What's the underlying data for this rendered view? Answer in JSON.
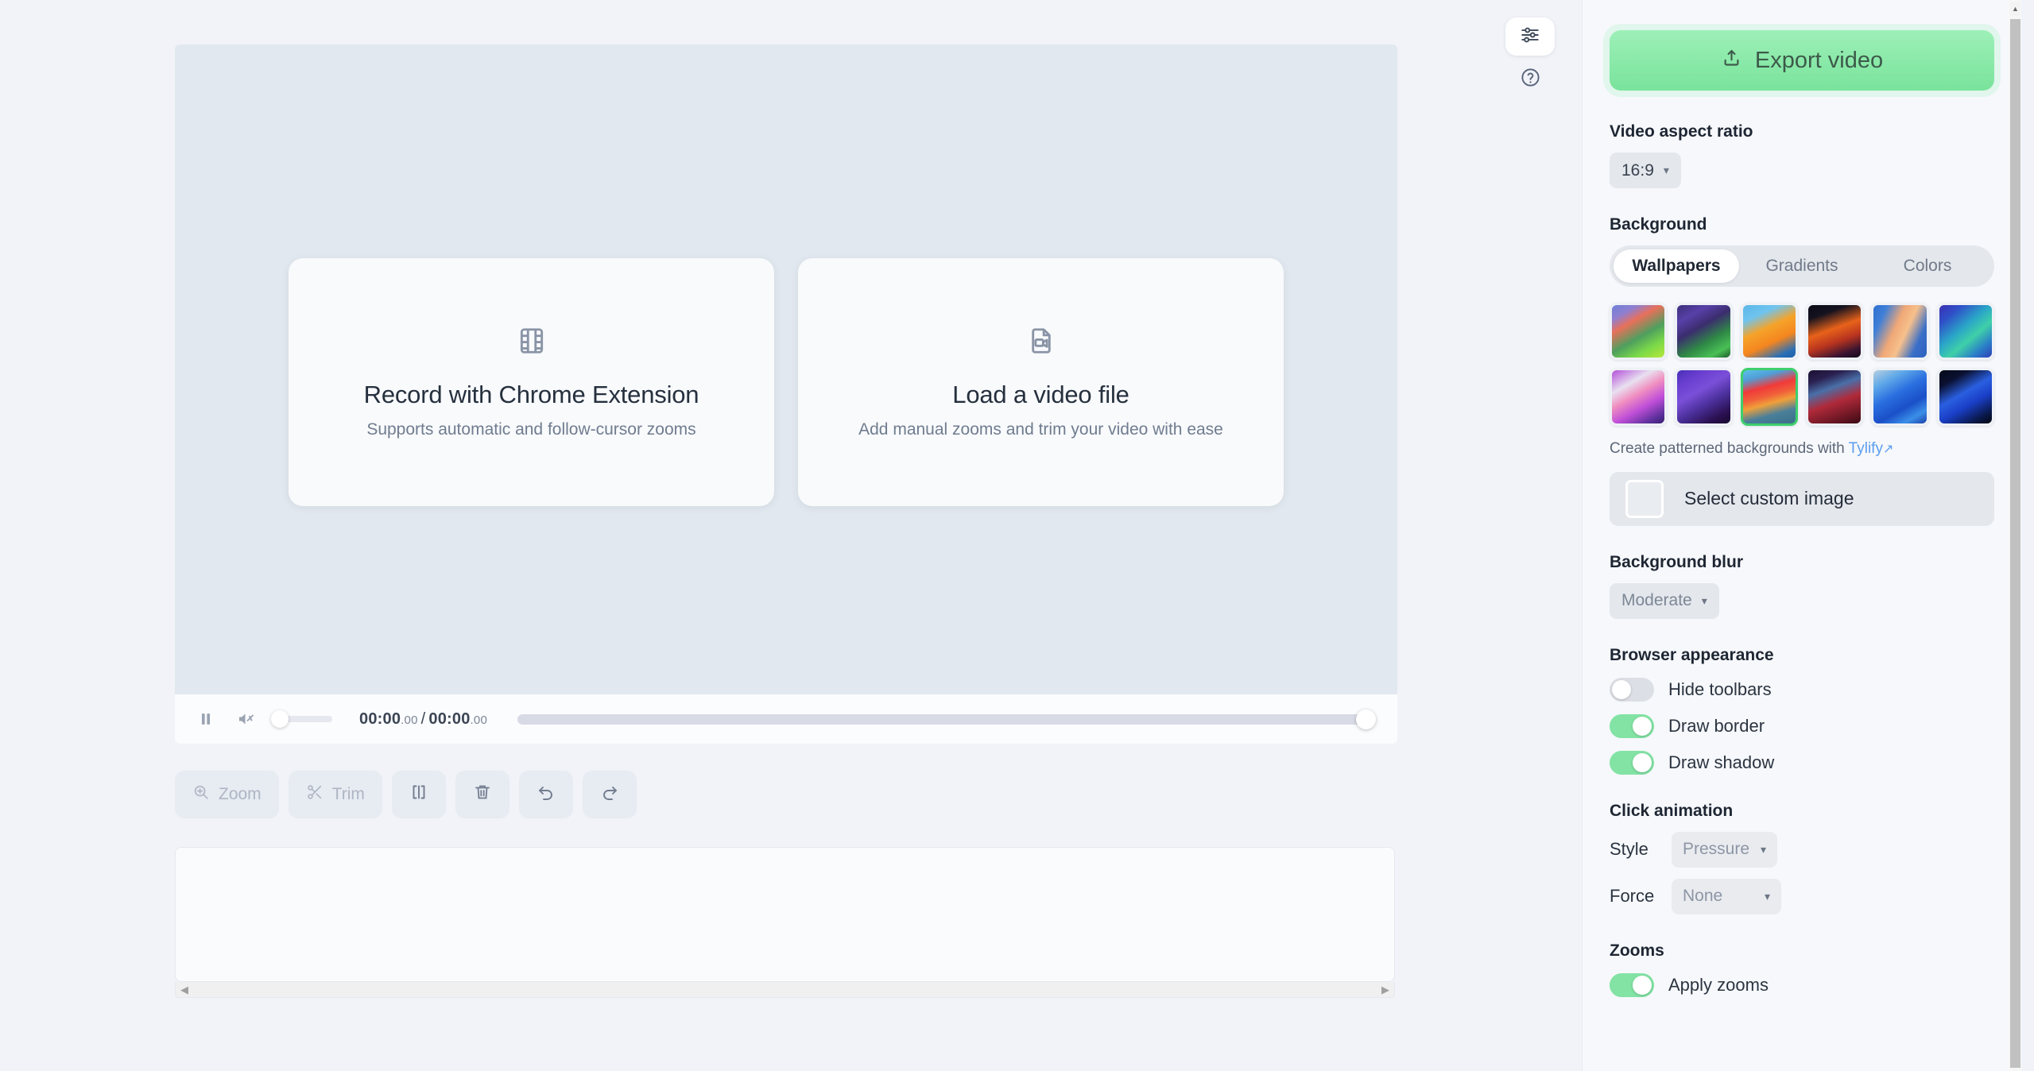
{
  "stage": {
    "cards": [
      {
        "icon": "film-strip-icon",
        "title": "Record with Chrome Extension",
        "subtitle": "Supports automatic and follow-cursor zooms"
      },
      {
        "icon": "video-file-icon",
        "title": "Load a video file",
        "subtitle": "Add manual zooms and trim your video with ease"
      }
    ]
  },
  "player": {
    "pause_icon": "pause-icon",
    "mute_icon": "speaker-muted-icon",
    "current_time": "00:00",
    "current_ms": ".00",
    "separator": "/",
    "total_time": "00:00",
    "total_ms": ".00"
  },
  "toolbar": {
    "buttons": [
      {
        "name": "zoom",
        "label": "Zoom",
        "icon": "zoom-in-icon"
      },
      {
        "name": "trim",
        "label": "Trim",
        "icon": "scissors-icon"
      },
      {
        "name": "split",
        "label": "",
        "icon": "split-clip-icon"
      },
      {
        "name": "delete",
        "label": "",
        "icon": "trash-icon"
      },
      {
        "name": "undo",
        "label": "",
        "icon": "undo-icon"
      },
      {
        "name": "redo",
        "label": "",
        "icon": "redo-icon"
      }
    ]
  },
  "timeline": {
    "scroll_left_arrow": "◀",
    "scroll_right_arrow": "▶"
  },
  "floating": {
    "settings_icon": "sliders-icon",
    "help_icon": "help-circle-icon"
  },
  "panel": {
    "export": {
      "label": "Export video",
      "icon": "upload-icon",
      "color": "#79e39b"
    },
    "aspect_ratio": {
      "label": "Video aspect ratio",
      "value": "16:9"
    },
    "background": {
      "label": "Background",
      "tabs": [
        {
          "label": "Wallpapers",
          "active": true
        },
        {
          "label": "Gradients",
          "active": false
        },
        {
          "label": "Colors",
          "active": false
        }
      ],
      "wallpapers": [
        {
          "id": 1,
          "selected": false,
          "css": "linear-gradient(150deg,#6f7fd8 0%,#8f7fd0 18%,#e8705a 34%,#4e9f5e 58%,#7ad84a 78%,#b6e83a 100%)"
        },
        {
          "id": 2,
          "selected": false,
          "css": "linear-gradient(150deg,#3c2f7a 0%,#5840a8 22%,#3b2d6e 42%,#2f8a46 66%,#49c055 85%,#1d5a2c 100%)"
        },
        {
          "id": 3,
          "selected": false,
          "css": "linear-gradient(155deg,#5bb6e8 0%,#6fc4ef 22%,#f5a32a 44%,#f5861f 66%,#2a6fb5 88%,#1e5fa8 100%)"
        },
        {
          "id": 4,
          "selected": false,
          "css": "linear-gradient(160deg,#0a0a14 0%,#14121f 20%,#e8621a 46%,#b8341f 66%,#3a1430 86%,#120a1a 100%)"
        },
        {
          "id": 5,
          "selected": false,
          "css": "linear-gradient(115deg,#2f6fd0 0%,#3f7fd8 18%,#f0a877 42%,#f6c08c 58%,#3a6fc8 80%,#2c5fc0 100%)"
        },
        {
          "id": 6,
          "selected": false,
          "css": "linear-gradient(140deg,#3b2fb0 0%,#2f50c8 20%,#2aa5c8 44%,#3fd0a8 62%,#2a7fc8 82%,#2f3fb8 100%)"
        },
        {
          "id": 7,
          "selected": false,
          "css": "linear-gradient(150deg,#b34fd8 0%,#e8e0f0 28%,#f08fc0 46%,#c04fd8 66%,#5a2f9a 88%,#3a1f70 100%)"
        },
        {
          "id": 8,
          "selected": false,
          "css": "linear-gradient(150deg,#4a2fb8 0%,#6a3fd0 20%,#7a4fd8 40%,#4a2f9a 62%,#2a1050 84%,#180a30 100%)"
        },
        {
          "id": 9,
          "selected": true,
          "css": "linear-gradient(165deg,#5fc0e8 0%,#4f9fd8 16%,#f03a3a 34%,#f0603a 48%,#f0a03a 60%,#4a7f9a 78%,#3a6f8a 100%)"
        },
        {
          "id": 10,
          "selected": false,
          "css": "linear-gradient(160deg,#1a1030 0%,#2a2050 18%,#4a6fa8 36%,#b02a3a 58%,#7a1a28 78%,#3a0a14 100%)"
        },
        {
          "id": 11,
          "selected": false,
          "css": "linear-gradient(150deg,#b8cfe0 0%,#5fa8e8 22%,#2a6fe0 44%,#1a4fc8 66%,#3a8fe8 84%,#1a3fa8 100%)"
        },
        {
          "id": 12,
          "selected": false,
          "css": "linear-gradient(150deg,#060a18 0%,#0a1030 20%,#2a5fe0 44%,#1a3fc8 62%,#0a1a50 84%,#04060f 100%)"
        }
      ],
      "hint_prefix": "Create patterned backgrounds with",
      "hint_link": "Tylify",
      "hint_link_icon": "external-link-icon",
      "custom_image_label": "Select custom image"
    },
    "background_blur": {
      "label": "Background blur",
      "value": "Moderate"
    },
    "browser_appearance": {
      "label": "Browser appearance",
      "toggles": [
        {
          "label": "Hide toolbars",
          "on": false
        },
        {
          "label": "Draw border",
          "on": true
        },
        {
          "label": "Draw shadow",
          "on": true
        }
      ]
    },
    "click_animation": {
      "label": "Click animation",
      "style": {
        "key": "Style",
        "value": "Pressure"
      },
      "force": {
        "key": "Force",
        "value": "None"
      }
    },
    "zooms": {
      "label": "Zooms",
      "apply": {
        "label": "Apply zooms",
        "on": true
      }
    }
  }
}
